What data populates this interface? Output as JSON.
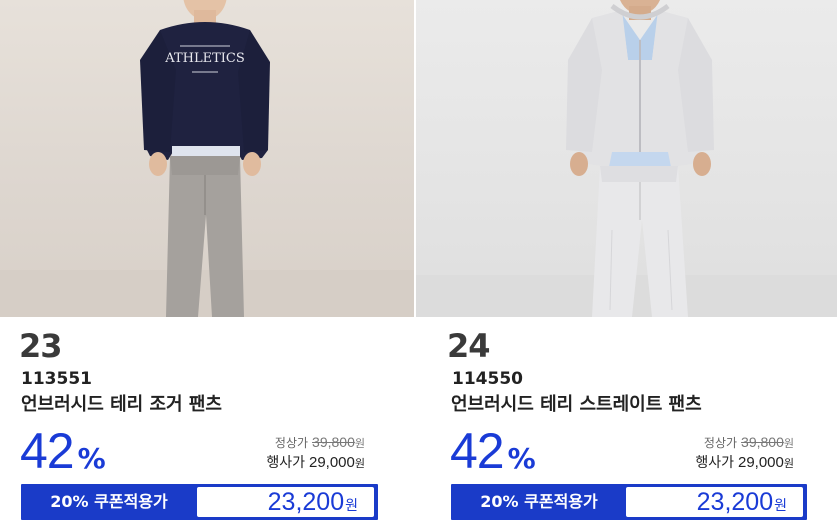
{
  "products": [
    {
      "rank": "23",
      "code": "113551",
      "name": "언브러시드 테리 조거 팬츠",
      "discount_value": "42",
      "discount_unit": "%",
      "regular_label": "정상가",
      "regular_price": "39,800",
      "regular_unit": "원",
      "event_label": "행사가",
      "event_price": "29,000",
      "event_unit": "원",
      "coupon_label": "20% 쿠폰적용가",
      "coupon_price": "23,200",
      "coupon_unit": "원",
      "image_desc": "athletics-sweatshirt-jogger-model"
    },
    {
      "rank": "24",
      "code": "114550",
      "name": "언브러시드 테리 스트레이트 팬츠",
      "discount_value": "42",
      "discount_unit": "%",
      "regular_label": "정상가",
      "regular_price": "39,800",
      "regular_unit": "원",
      "event_label": "행사가",
      "event_price": "29,000",
      "event_unit": "원",
      "coupon_label": "20% 쿠폰적용가",
      "coupon_price": "23,200",
      "coupon_unit": "원",
      "image_desc": "grey-hoodie-straight-pants-model"
    }
  ],
  "graphic_text": {
    "sweatshirt_print": "ATHLETICS"
  },
  "colors": {
    "accent": "#1a3bd6",
    "coupon_bg": "#1a3bc8",
    "text": "#222222",
    "rank_text": "#3a3a3a"
  }
}
